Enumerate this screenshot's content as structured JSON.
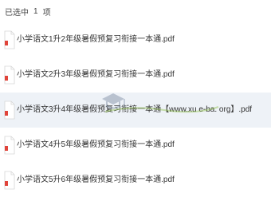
{
  "header": {
    "selected_label": "已选中",
    "selected_count": "1",
    "selected_unit": "项"
  },
  "files": [
    {
      "name": "小学语文1升2年级暑假预复习衔接一本通.pdf",
      "icon": "pdf-file-icon",
      "selected": false
    },
    {
      "name": "小学语文2升3年级暑假预复习衔接一本通.pdf",
      "icon": "pdf-file-icon",
      "selected": false
    },
    {
      "name": "小学语文3升4年级暑假预复习衔接一本通【www.xu e-ba. org】.pdf",
      "icon": "pdf-file-icon",
      "selected": true
    },
    {
      "name": "小学语文4升5年级暑假预复习衔接一本通.pdf",
      "icon": "pdf-file-icon",
      "selected": false
    },
    {
      "name": "小学语文5升6年级暑假预复习衔接一本通.pdf",
      "icon": "pdf-file-icon",
      "selected": false
    }
  ],
  "colors": {
    "pdf_accent": "#e0443a",
    "selected_row": "#eef2f7",
    "text": "#333333"
  }
}
